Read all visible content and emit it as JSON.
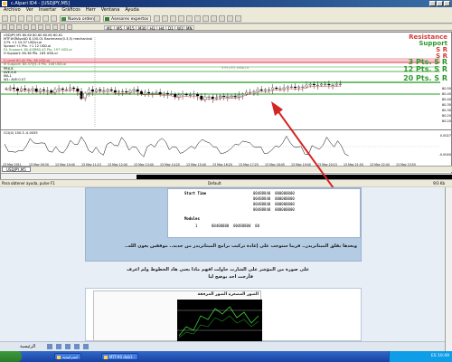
{
  "window": {
    "title": "c.Alpari ID4 - [USDJPY,M5]",
    "menu": [
      "Archivo",
      "Ver",
      "Insertar",
      "Gráficos",
      "Herr",
      "Ventana",
      "Ayuda"
    ]
  },
  "toolbar": {
    "new_order": "Nueva orden",
    "expert_advisors": "Asesores expertos",
    "timeframes": [
      "M1",
      "M5",
      "M15",
      "M30",
      "H1",
      "H4",
      "D1",
      "W1",
      "MN"
    ]
  },
  "chart": {
    "symbol_header": "USDJPY,M5  80.60 80.60 80.60 80.61",
    "indicator_lines": [
      "MTF#SRAveAD 8.100.01 Bachmann(0.3,5) mechanical",
      "3 Pt. +1 15.57 USDcl.oi",
      "Spread +1 Pts. +1 12 USD.oi",
      "DL Support: 80.40@80.43 Pts. 197 USD.oi",
      "H Support: 80.38 Pts. 183 USD.oi",
      "S Level 80.42 Pts. 96 USD.oi",
      "M Support: 80.37@1.3 Pts. 148 USD.oi",
      "PRX.8",
      "AVE.0.8",
      "MA.1",
      "W1: AVE:0.57"
    ],
    "sr_labels": {
      "resistance": "Resistance",
      "support": "Support",
      "sr1": "S R",
      "sr2": "S R",
      "pts3": "3 Pts. S R",
      "pts12": "12 Pts. S R",
      "pts20": "20 Pts. S R"
    },
    "midlabels": {
      "upper": "3 Pt (3T) USDl,nt",
      "lower": "8 Pt (3T) USDl,ni"
    },
    "price_ticks": [
      "80.50",
      "80.45",
      "80.40",
      "80.35",
      "80.30",
      "80.25",
      "80.20"
    ],
    "oscillator_label": "CCI(4) 100.3 -0.0035",
    "osc_ticks": [
      "0.0027",
      "-0.0040"
    ],
    "time_labels": [
      "13 May 2011",
      "13 May 09:30",
      "13 May 10:40",
      "13 May 11:15",
      "13 May 12:40",
      "13 May 13:40",
      "13 May 14:20",
      "13 May 15:40",
      "13 May 16:20",
      "13 May 17:25",
      "13 May 18:45",
      "13 May 19:00",
      "13 May 20:15",
      "13 May 21:50",
      "13 May 22:40",
      "13 May 23:55"
    ],
    "tab": "USDJPY,M5"
  },
  "status": {
    "left": "Balance",
    "help": "Para obtener ayuda, pulse F1",
    "default": "Default",
    "right": "9/3 Kb"
  },
  "forum": {
    "code_lines": [
      {
        "label": "Start Time",
        "value": "00488840  000000000"
      },
      {
        "label": "",
        "value": "00488840  000000000"
      },
      {
        "label": "",
        "value": "00488840  000000000"
      },
      {
        "label": "",
        "value": "00488840  000000000"
      },
      {
        "label": "Modules",
        "value": ""
      },
      {
        "label": "1",
        "value": "00400000  00488800  00"
      }
    ],
    "post_text_1": "وبعدها يقلق الميتاتريدر.. قريبا ستوجب على إعادة تركيب برامج الميتاتريدر من جديد.. موفقين يعون الله..",
    "post_text_2": "على صورة من المؤشر على الشارت حاولت افهم ماذا يعني هاد الخطوط ولم اعرف",
    "post_text_3": "فأرجت احد يوضح لنا",
    "image_caption": "الصور المصغرة الصور المرفقة",
    "bottom_label": "الرئيسية"
  },
  "taskbar": {
    "items": [
      "استراتيجية",
      "MTF#S dub1 -"
    ],
    "clock": "ES 10:49"
  },
  "colors": {
    "arrow": "#d42424",
    "resistance": "#d43a3a",
    "support": "#2e9a2e",
    "sr_band": "#f8c8d0",
    "green_line": "#1c9c1c"
  }
}
